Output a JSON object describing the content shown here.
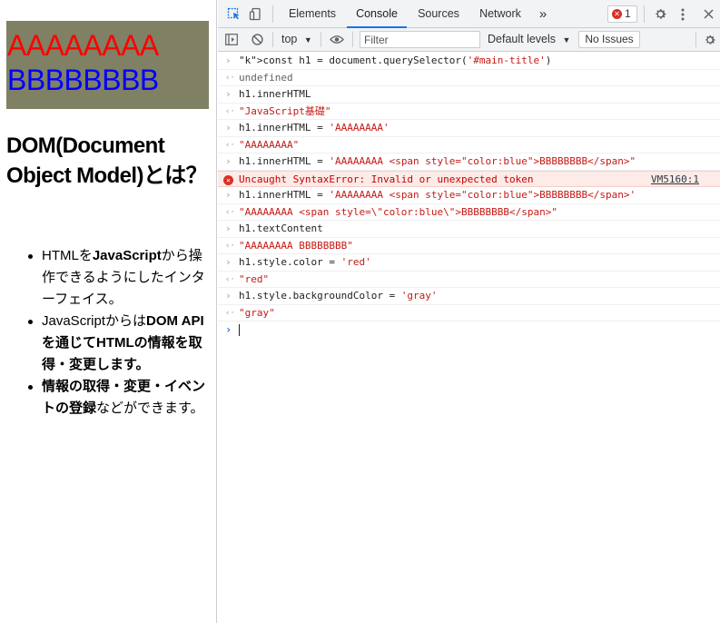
{
  "page": {
    "title_red": "AAAAAAAA",
    "title_blue": "BBBBBBBB",
    "heading": "DOM(Document Object Model)とは？",
    "list": [
      {
        "parts": [
          {
            "t": "HTMLを",
            "b": false
          },
          {
            "t": "JavaScript",
            "b": true
          },
          {
            "t": "から操作できるようにしたインターフェイス。",
            "b": false
          }
        ]
      },
      {
        "parts": [
          {
            "t": "JavaScriptからは",
            "b": false
          },
          {
            "t": "DOM APIを通じてHTMLの情報を取得・変更します。",
            "b": true
          }
        ]
      },
      {
        "parts": [
          {
            "t": "情報の取得・変更・イベントの登録",
            "b": true
          },
          {
            "t": "などができます。",
            "b": false
          }
        ]
      }
    ]
  },
  "devtools": {
    "tabs": [
      "Elements",
      "Console",
      "Sources",
      "Network"
    ],
    "active_tab": "Console",
    "more_tabs": "»",
    "error_count": "1",
    "toolbar": {
      "context": "top",
      "filter_placeholder": "Filter",
      "levels": "Default levels",
      "issues": "No Issues"
    },
    "console": [
      {
        "type": "in",
        "text": "const h1 = document.querySelector('#main-title')"
      },
      {
        "type": "out",
        "text": "undefined"
      },
      {
        "type": "in",
        "text": "h1.innerHTML"
      },
      {
        "type": "out",
        "text": "\"JavaScript基礎\""
      },
      {
        "type": "in",
        "text": "h1.innerHTML = 'AAAAAAAA'"
      },
      {
        "type": "out",
        "text": "\"AAAAAAAA\""
      },
      {
        "type": "in",
        "text": "h1.innerHTML = 'AAAAAAAA <span style=\"color:blue\">BBBBBBBB</span>\""
      },
      {
        "type": "error",
        "text": "Uncaught SyntaxError: Invalid or unexpected token",
        "source": "VM5160:1"
      },
      {
        "type": "in",
        "text": "h1.innerHTML = 'AAAAAAAA <span style=\"color:blue\">BBBBBBBB</span>'"
      },
      {
        "type": "out",
        "text": "\"AAAAAAAA <span style=\\\"color:blue\\\">BBBBBBBB</span>\""
      },
      {
        "type": "in",
        "text": "h1.textContent"
      },
      {
        "type": "out",
        "text": "\"AAAAAAAA BBBBBBBB\""
      },
      {
        "type": "in",
        "text": "h1.style.color = 'red'"
      },
      {
        "type": "out",
        "text": "\"red\""
      },
      {
        "type": "in",
        "text": "h1.style.backgroundColor = 'gray'"
      },
      {
        "type": "out",
        "text": "\"gray\""
      }
    ]
  },
  "colors": {
    "title_bg": "#808064",
    "title_red": "#ff0000",
    "title_blue": "#0000ff",
    "accent": "#1a73e8",
    "error": "#d93025"
  }
}
